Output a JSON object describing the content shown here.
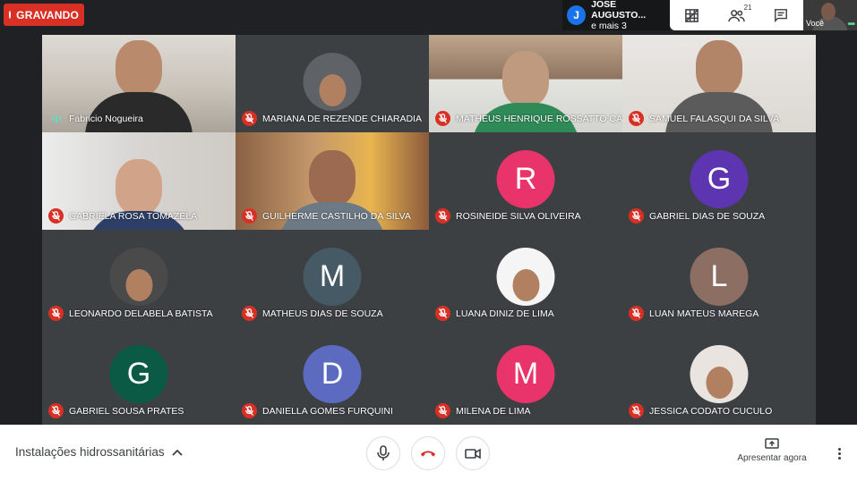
{
  "recording": {
    "label": "GRAVANDO"
  },
  "presenters": {
    "avatar_letter": "J",
    "name": "JOSE AUGUSTO...",
    "more": "e mais 3"
  },
  "toolbar": {
    "participants_count": "21"
  },
  "self_view": {
    "label": "Você"
  },
  "participants": [
    {
      "name": "Fabricio Nogueira",
      "mic": "speaking",
      "tile": "video-a"
    },
    {
      "name": "MARIANA DE REZENDE CHIARADIA",
      "mic": "muted",
      "tile": "photo",
      "avatar_color": "#5f6368"
    },
    {
      "name": "MATHEUS HENRIQUE ROSSATTO CASOLA",
      "mic": "muted",
      "tile": "video-b"
    },
    {
      "name": "SAMUEL FALASQUI DA SILVA",
      "mic": "muted",
      "tile": "video-c"
    },
    {
      "name": "GABRIELA ROSA TOMAZELA",
      "mic": "muted",
      "tile": "video-d"
    },
    {
      "name": "GUILHERME CASTILHO DA SILVA",
      "mic": "muted",
      "tile": "video-e"
    },
    {
      "name": "ROSINEIDE SILVA OLIVEIRA",
      "mic": "muted",
      "tile": "letter",
      "letter": "R",
      "avatar_color": "#e8336b"
    },
    {
      "name": "GABRIEL DIAS DE SOUZA",
      "mic": "muted",
      "tile": "letter",
      "letter": "G",
      "avatar_color": "#5e35b1"
    },
    {
      "name": "LEONARDO DELABELA BATISTA",
      "mic": "muted",
      "tile": "photo",
      "avatar_color": "#4a4a4a"
    },
    {
      "name": "MATHEUS DIAS DE SOUZA",
      "mic": "muted",
      "tile": "letter",
      "letter": "M",
      "avatar_color": "#455a64"
    },
    {
      "name": "LUANA DINIZ DE LIMA",
      "mic": "muted",
      "tile": "photo",
      "avatar_color": "#f5f5f5"
    },
    {
      "name": "LUAN MATEUS MAREGA",
      "mic": "muted",
      "tile": "letter",
      "letter": "L",
      "avatar_color": "#8d6e63"
    },
    {
      "name": "GABRIEL SOUSA PRATES",
      "mic": "muted",
      "tile": "letter",
      "letter": "G",
      "avatar_color": "#0b5a45"
    },
    {
      "name": "DANIELLA GOMES FURQUINI",
      "mic": "muted",
      "tile": "letter",
      "letter": "D",
      "avatar_color": "#5c6bc0"
    },
    {
      "name": "MILENA DE LIMA",
      "mic": "muted",
      "tile": "letter",
      "letter": "M",
      "avatar_color": "#e8336b"
    },
    {
      "name": "JESSICA CODATO CUCULO",
      "mic": "muted",
      "tile": "photo",
      "avatar_color": "#e9e4df"
    }
  ],
  "bottom": {
    "meeting_title": "Instalações hidrossanitárias",
    "present_label": "Apresentar agora"
  },
  "colors": {
    "accent_red": "#d93025",
    "bg_dark": "#202124",
    "tile_bg": "#3c4043"
  },
  "icons": [
    "record-dot-icon",
    "grid-view-icon",
    "people-icon",
    "chat-icon",
    "mic-off-icon",
    "speaking-icon",
    "chevron-up-icon",
    "mic-icon",
    "hang-up-icon",
    "camera-icon",
    "present-icon",
    "more-vert-icon"
  ]
}
